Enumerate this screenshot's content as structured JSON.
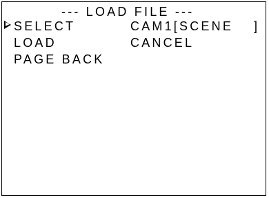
{
  "screen": {
    "title": "--- LOAD FILE ---",
    "cursor_icon": "triangle-right-outline-icon",
    "menu": [
      {
        "label": "SELECT",
        "value": "CAM1[SCENE",
        "value_end": "]"
      },
      {
        "label": "LOAD",
        "value": "CANCEL"
      },
      {
        "label": "PAGE BACK"
      }
    ]
  }
}
